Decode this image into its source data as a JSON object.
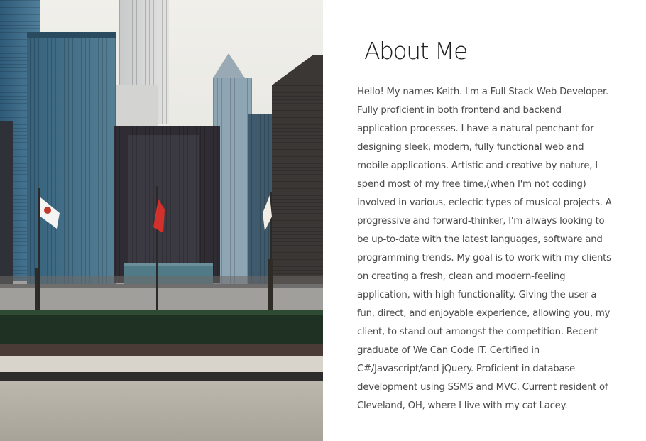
{
  "about": {
    "title": "About Me",
    "bio_before_link": "Hello! My names Keith. I'm a Full Stack Web Developer. Fully proficient in both frontend and backend application processes. I have a natural penchant for designing sleek, modern, fully functional web and mobile applications. Artistic and creative by nature, I spend most of my free time,(when I'm not coding) involved in various, eclectic types of musical projects. A progressive and forward-thinker, I'm always looking to be up-to-date with the latest languages, software and programming trends. My goal is to work with my clients on creating a fresh, clean and modern-feeling application, with high functionality. Giving the user a fun, direct, and enjoyable experience, allowing you, my client, to stand out amongst the competition. Recent graduate of ",
    "link_text": "We Can Code IT.",
    "bio_after_link": " Certified in C#/Javascript/and jQuery. Proficient in database development using SSMS and MVC. Current resident of Cleveland, OH, where I live with my cat Lacey."
  },
  "colors": {
    "sky": "#e9e8e4",
    "building_dark": "#2b2a2c",
    "building_glass": "#3d6a86",
    "hedge": "#1f3324",
    "text": "#4a4a4a",
    "title": "#1f1f1f"
  }
}
